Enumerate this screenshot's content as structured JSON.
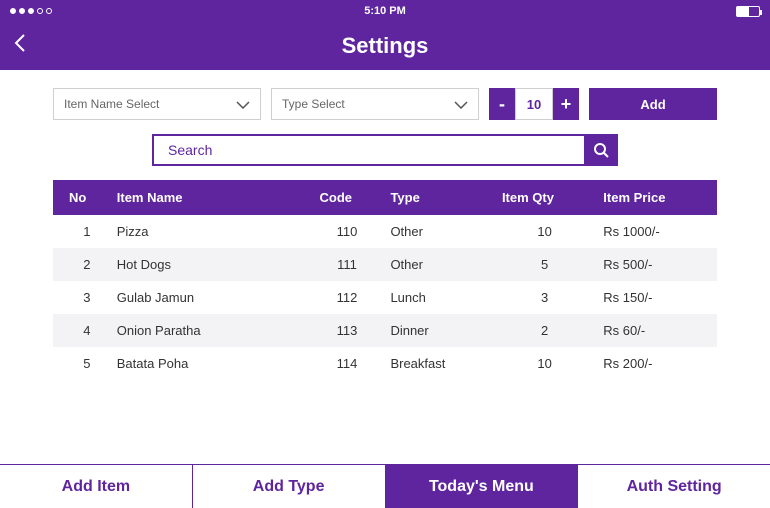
{
  "status": {
    "time": "5:10 PM"
  },
  "header": {
    "title": "Settings"
  },
  "controls": {
    "item_select_placeholder": "Item Name Select",
    "type_select_placeholder": "Type Select",
    "qty_value": "10",
    "add_label": "Add"
  },
  "search": {
    "placeholder": "Search"
  },
  "table": {
    "headers": {
      "no": "No",
      "name": "Item Name",
      "code": "Code",
      "type": "Type",
      "qty": "Item Qty",
      "price": "Item Price"
    },
    "rows": [
      {
        "no": "1",
        "name": "Pizza",
        "code": "110",
        "type": "Other",
        "qty": "10",
        "price": "Rs 1000/-"
      },
      {
        "no": "2",
        "name": "Hot Dogs",
        "code": "111",
        "type": "Other",
        "qty": "5",
        "price": "Rs 500/-"
      },
      {
        "no": "3",
        "name": "Gulab Jamun",
        "code": "112",
        "type": "Lunch",
        "qty": "3",
        "price": "Rs 150/-"
      },
      {
        "no": "4",
        "name": "Onion Paratha",
        "code": "113",
        "type": "Dinner",
        "qty": "2",
        "price": "Rs 60/-"
      },
      {
        "no": "5",
        "name": "Batata Poha",
        "code": "114",
        "type": "Breakfast",
        "qty": "10",
        "price": "Rs 200/-"
      }
    ]
  },
  "tabs": {
    "add_item": "Add Item",
    "add_type": "Add Type",
    "todays_menu": "Today's Menu",
    "auth_setting": "Auth Setting"
  }
}
